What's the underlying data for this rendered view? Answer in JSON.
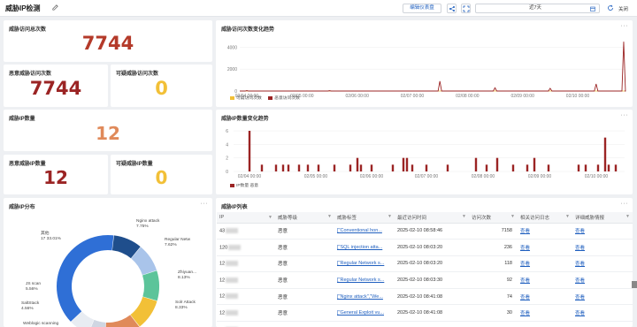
{
  "header": {
    "title": "威胁IP检测",
    "report_btn": "编辑仪表盘",
    "range_value": "近7天",
    "close_label": "关闭"
  },
  "kpi": {
    "threat_total": {
      "label": "威胁访问总次数",
      "value": "7744"
    },
    "malicious_visits": {
      "label": "恶意威胁访问次数",
      "value": "7744"
    },
    "suspicious_visits": {
      "label": "可疑威胁访问次数",
      "value": "0"
    },
    "threat_ip_count": {
      "label": "威胁IP数量",
      "value": "12"
    },
    "malicious_ip": {
      "label": "恶意威胁IP数量",
      "value": "12"
    },
    "suspicious_ip": {
      "label": "可疑威胁IP数量",
      "value": "0"
    }
  },
  "visits_chart": {
    "title": "威胁访问次数变化趋势",
    "y_ticks": [
      "4000",
      "2000",
      "0"
    ],
    "x_ticks": [
      "02/04 00:00",
      "02/05 00:00",
      "02/06 00:00",
      "02/07 00:00",
      "02/08 00:00",
      "02/09 00:00",
      "02/10 00:00"
    ],
    "legend": [
      "可疑访问次数",
      "恶意访问次数"
    ]
  },
  "ipcount_chart": {
    "title": "威胁IP数量变化趋势",
    "y_ticks": [
      "6",
      "4",
      "2",
      "0"
    ],
    "x_ticks": [
      "02/04 00:00",
      "02/05 00:00",
      "02/06 00:00",
      "02/07 00:00",
      "02/08 00:00",
      "02/09 00:00",
      "02/10 00:00"
    ],
    "legend": [
      "IP数量 恶意"
    ]
  },
  "chart_data": [
    {
      "type": "line",
      "title": "威胁访问次数变化趋势",
      "ylim": [
        0,
        5000
      ],
      "series": [
        {
          "name": "可疑访问次数",
          "values": [
            0,
            0,
            0,
            0,
            0,
            0,
            0
          ]
        },
        {
          "name": "恶意访问次数",
          "peaks": [
            {
              "x": "02/04 00:00",
              "y": 40
            },
            {
              "x": "02/05 12:00",
              "y": 30
            },
            {
              "x": "02/07 12:00",
              "y": 900
            },
            {
              "x": "02/08 12:00",
              "y": 300
            },
            {
              "x": "02/09 12:00",
              "y": 250
            },
            {
              "x": "02/10 08:00",
              "y": 650
            },
            {
              "x": "02/10 20:00",
              "y": 4500
            }
          ]
        }
      ]
    },
    {
      "type": "bar",
      "title": "威胁IP数量变化趋势",
      "ylim": [
        0,
        6
      ],
      "series": [
        {
          "name": "IP数量 恶意",
          "bars": [
            6,
            1,
            1,
            1,
            1,
            1,
            1,
            1,
            1,
            1,
            2,
            1,
            1,
            1,
            2,
            2,
            1,
            1,
            1,
            2,
            1,
            2,
            1,
            1,
            2,
            1,
            1,
            1,
            1,
            5,
            1,
            1
          ]
        }
      ]
    },
    {
      "type": "pie",
      "title": "威胁IP分布",
      "slices": [
        {
          "label": "Nginx attack",
          "value": 7.75
        },
        {
          "label": "Regular Network attack",
          "value": 7.62
        },
        {
          "label": "Zhiyuan attack",
          "value": 8.13
        },
        {
          "label": "Solr Attack",
          "value": 8.33
        },
        {
          "label": "Weblogic scanning",
          "value": 9.7
        },
        {
          "label": "SaltStack",
          "value": 4.56
        },
        {
          "label": "JS scan",
          "value": 5.56
        },
        {
          "label": "其他",
          "value": 33.01
        }
      ]
    }
  ],
  "pie": {
    "title": "威胁IP分布",
    "labels": [
      {
        "name": "Nginx attack",
        "pct": "7.75%"
      },
      {
        "name": "Regular Netw",
        "pct": "7.62%"
      },
      {
        "name": "Zhiyuan...",
        "pct": "8.13%"
      },
      {
        "name": "Solr Attack",
        "pct": "8.33%"
      },
      {
        "name": "Weblogic scanning",
        "pct": ""
      },
      {
        "name": "SaltStack",
        "pct": "4.56%"
      },
      {
        "name": "JS scan",
        "pct": "5.56%"
      },
      {
        "name": "其他",
        "pct": "17 33.01%"
      }
    ]
  },
  "table": {
    "title": "威胁IP列表",
    "headers": [
      "IP",
      "威胁等级",
      "威胁标签",
      "最近访问时间",
      "访问次数",
      "相关访问日志",
      "详细威胁情报"
    ],
    "rows": [
      {
        "ip": "43",
        "level": "恶意",
        "tag": "[\"Conventional hon...",
        "time": "2025-02-10 08:58:46",
        "count": "7158",
        "log": "查看",
        "intel": "查看"
      },
      {
        "ip": "120",
        "level": "恶意",
        "tag": "[\"SQL injection atta...",
        "time": "2025-02-10 08:03:20",
        "count": "236",
        "log": "查看",
        "intel": "查看"
      },
      {
        "ip": "12",
        "level": "恶意",
        "tag": "[\"Regular Network s...",
        "time": "2025-02-10 08:03:20",
        "count": "118",
        "log": "查看",
        "intel": "查看"
      },
      {
        "ip": "12",
        "level": "恶意",
        "tag": "[\"Regular Network s...",
        "time": "2025-02-10 08:03:30",
        "count": "92",
        "log": "查看",
        "intel": "查看"
      },
      {
        "ip": "12",
        "level": "恶意",
        "tag": "[\"Nginx attack\",\"We...",
        "time": "2025-02-10 08:41:08",
        "count": "74",
        "log": "查看",
        "intel": "查看"
      },
      {
        "ip": "12",
        "level": "恶意",
        "tag": "[\"General Exploit vu...",
        "time": "2025-02-10 08:41:08",
        "count": "30",
        "log": "查看",
        "intel": "查看"
      },
      {
        "ip": "11",
        "level": "恶意",
        "tag": "[\"SQL injection atta...",
        "time": "2025-02-09 18:11:21",
        "count": "12",
        "log": "查看",
        "intel": "查看"
      }
    ]
  }
}
